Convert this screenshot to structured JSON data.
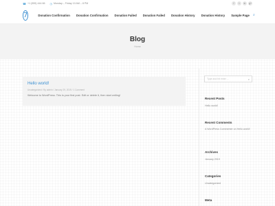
{
  "topbar": {
    "phone": "+1 (555) 444 66",
    "hours": "Monday – Friday 10 AM – 8 PM"
  },
  "social": [
    "f",
    "t",
    "in",
    "g+"
  ],
  "logo": {
    "glyph": "7"
  },
  "nav": {
    "items": [
      "Donation Confirmation",
      "Donation Confirmation",
      "Donation Failed",
      "Donation Failed",
      "Donation History",
      "Donation History",
      "Sample Page"
    ]
  },
  "hero": {
    "title": "Blog",
    "breadcrumb": "Home"
  },
  "post": {
    "title": "Hello world!",
    "meta": "Uncategorized  /  By admin  /  January 29, 2019  /  1 Comment",
    "excerpt": "Welcome to WordPress. This is your first post. Edit or delete it, then start writing!"
  },
  "sidebar": {
    "search_placeholder": "Type and hit enter ...",
    "recent_posts": {
      "title": "Recent Posts",
      "items": [
        "Hello world!"
      ]
    },
    "recent_comments": {
      "title": "Recent Comments",
      "text": "A WordPress Commenter on Hello world!"
    },
    "archives": {
      "title": "Archives",
      "items": [
        "January 2019"
      ]
    },
    "categories": {
      "title": "Categories",
      "items": [
        "Uncategorized"
      ]
    },
    "meta": {
      "title": "Meta"
    }
  },
  "colors": {
    "accent": "#3c8fd1",
    "hero_bg": "#f3f3f3",
    "heading": "#333333"
  }
}
